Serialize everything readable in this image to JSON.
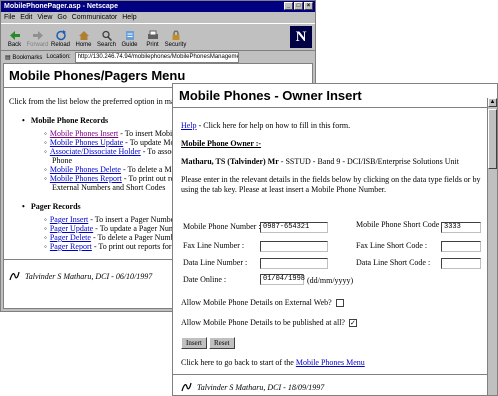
{
  "browser": {
    "title": "MobilePhonePager.asp - Netscape",
    "menu": [
      "File",
      "Edit",
      "View",
      "Go",
      "Communicator",
      "Help"
    ],
    "toolbar": [
      "Back",
      "Forward",
      "Reload",
      "Home",
      "Search",
      "Guide",
      "Print",
      "Security"
    ],
    "bookmarks_label": "Bookmarks",
    "location_label": "Location:",
    "url": "http://130.246.74.94/mobilephones/MobilePhonesManagement.asp",
    "logo": "N"
  },
  "menu_page": {
    "title": "Mobile Phones/Pagers Menu",
    "intro": "Click from the list below the preferred option in maintain",
    "mobile_section": "Mobile Phone Records",
    "mobile_links": [
      {
        "link": "Mobile Phones Insert",
        "desc": " - To insert Mobile P"
      },
      {
        "link": "Mobile Phones Update",
        "desc": " - To update Mobil"
      },
      {
        "link": "Associate/Dissociate Holder",
        "desc": " - To associat"
      }
    ],
    "mobile_cont1": "Phone",
    "mobile_links2": [
      {
        "link": "Mobile Phones Delete",
        "desc": " - To delete a Mobil"
      },
      {
        "link": "Mobile Phones Report",
        "desc": " - To print out rep"
      }
    ],
    "mobile_cont2": "External Numbers and Short Codes",
    "pager_section": "Pager Records",
    "pager_links": [
      {
        "link": "Pager Insert",
        "desc": " - To insert a Pager Number in"
      },
      {
        "link": "Pager Update",
        "desc": " - To update a Pager Numb"
      },
      {
        "link": "Pager Delete",
        "desc": " - To delete a Pager Numb"
      },
      {
        "link": "Pager Report",
        "desc": " - To print out reports for the"
      }
    ],
    "footer": "Talvinder S Matharu, DCI - 06/10/1997"
  },
  "insert_page": {
    "title": "Mobile Phones - Owner Insert",
    "help_link": "Help",
    "help_text": " - Click here for help on how to fill in this form.",
    "owner_heading": "Mobile Phone Owner :-",
    "owner_name": "Matharu, TS (Talvinder) Mr",
    "owner_rest": " - SSTUD - Band 9 - DCI/ISB/Enterprise Solutions Unit",
    "instructions": "Please enter in the relevant details in the fields below by clicking on the data type fields or by using the tab key. Please at least insert a Mobile Phone Number.",
    "fields": {
      "mobile_number_label": "Mobile Phone Number :",
      "mobile_number_value": "0987-654321",
      "mobile_short_label": "Mobile Phone Short Code",
      "mobile_short_value": "3333",
      "fax_number_label": "Fax Line Number :",
      "fax_number_value": "",
      "fax_short_label": "Fax Line Short Code :",
      "fax_short_value": "",
      "data_number_label": "Data Line Number :",
      "data_number_value": "",
      "data_short_label": "Data Line Short Code :",
      "data_short_value": "",
      "date_label": "Date Online :",
      "date_value": "01/04/1998",
      "date_hint": "(dd/mm/yyyy)"
    },
    "allow_external_label": "Allow Mobile Phone Details on External Web?",
    "allow_external_checked": false,
    "allow_publish_label": "Allow Mobile Phone Details to be published at all?",
    "allow_publish_checked": true,
    "publish_mark": "✓",
    "insert_button": "Insert",
    "reset_button": "Reset",
    "back_text": "Click here to go back to start of the ",
    "back_link": "Mobile Phones Menu",
    "footer": "Talvinder S Matharu, DCI - 18/09/1997"
  }
}
